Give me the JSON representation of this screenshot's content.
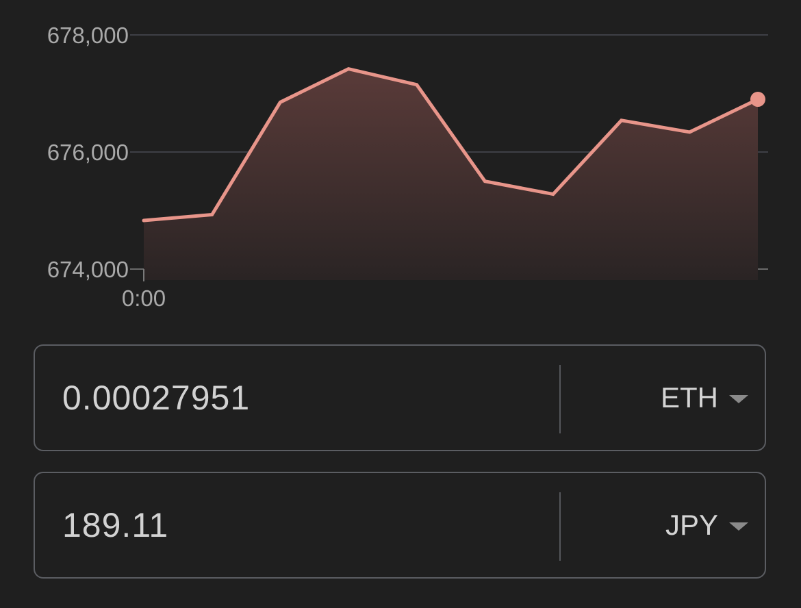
{
  "chart_data": {
    "type": "area",
    "x_tick_labels": [
      "0:00"
    ],
    "y_ticks": [
      674000,
      676000,
      678000
    ],
    "y_tick_labels": [
      "674,000",
      "676,000",
      "678,000"
    ],
    "ylim": [
      674000,
      678000
    ],
    "grid": true,
    "series": [
      {
        "values": [
          674830,
          674930,
          676850,
          677420,
          677150,
          675500,
          675280,
          676540,
          676340,
          676900
        ]
      }
    ],
    "line_color": "#e8958a",
    "fill_color": "#5a3b39"
  },
  "converter": {
    "crypto": {
      "amount": "0.00027951",
      "currency": "ETH"
    },
    "fiat": {
      "amount": "189.11",
      "currency": "JPY"
    }
  }
}
